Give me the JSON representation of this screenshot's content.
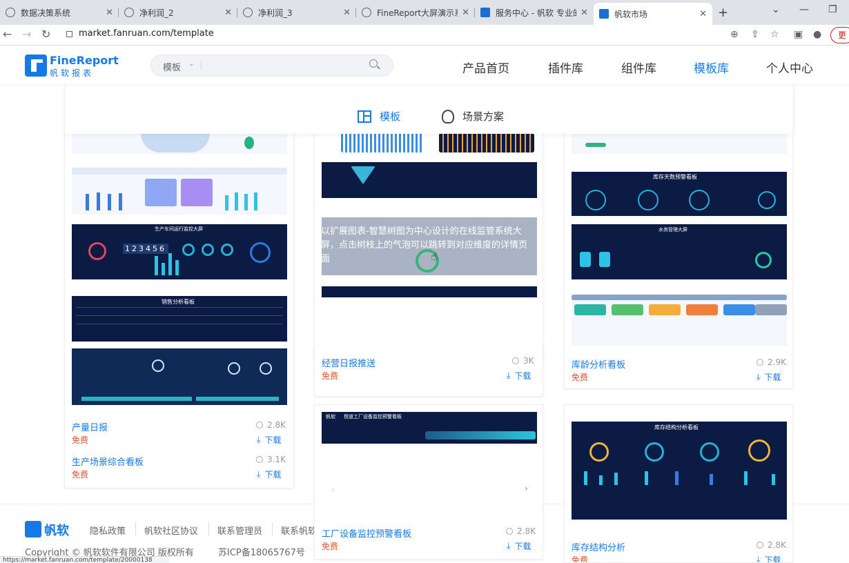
{
  "browser": {
    "tabs": [
      {
        "title": "数据决策系统"
      },
      {
        "title": "净利润_2"
      },
      {
        "title": "净利润_3"
      },
      {
        "title": "FineReport大屏演示系统"
      },
      {
        "title": "服务中心 - 帆软 专业的"
      },
      {
        "title": "帆软市场"
      }
    ],
    "url": "market.fanruan.com/template",
    "update_label": "更新",
    "status_url": "https://market.fanruan.com/template/20000138"
  },
  "header": {
    "logo_en": "FineReport",
    "logo_cn": "帆软报表",
    "search_category": "模板",
    "search_placeholder": "",
    "nav": [
      "产品首页",
      "插件库",
      "组件库",
      "模板库",
      "个人中心"
    ]
  },
  "subtabs": {
    "template": "模板",
    "scenario": "场景方案"
  },
  "overlay_text": "以扩展图表-智慧树图为中心设计的在线监管系统大屏，点击树枝上的气泡可以跳转到对应维度的详情",
  "overlay_text_tail": "页面",
  "cards": [
    {
      "title": "产量日报",
      "price": "免费",
      "views": "2.8K",
      "download": "下载"
    },
    {
      "title": "生产场景综合看板",
      "price": "免费",
      "views": "3.1K",
      "download": "下载"
    },
    {
      "title": "经营日报推送",
      "price": "免费",
      "views": "3K",
      "download": "下载"
    },
    {
      "title": "工厂设备监控预警看板",
      "price": "免费",
      "views": "2.8K",
      "download": "下载"
    },
    {
      "title": "库龄分析看板",
      "price": "免费",
      "views": "2.9K",
      "download": "下载"
    },
    {
      "title": "库存结构分析",
      "price": "免费",
      "views": "2.8K",
      "download": "下载"
    }
  ],
  "thumb_labels": {
    "t1": "生产车间运行监控大屏",
    "t1_digits": "123456",
    "t2": "销售分析看板",
    "t3": "库存天数预警看板",
    "t4": "库存结构分析看板",
    "t5": "帆软",
    "t5b": "悦道工厂设备监控预警看板",
    "t6": "水务管理大屏"
  },
  "footer": {
    "brand": "帆软",
    "links": [
      "隐私政策",
      "帆软社区协议",
      "联系管理员",
      "联系帆软"
    ],
    "copyright": "Copyright © 帆软软件有限公司 版权所有",
    "icp": "苏ICP备18065767号"
  }
}
